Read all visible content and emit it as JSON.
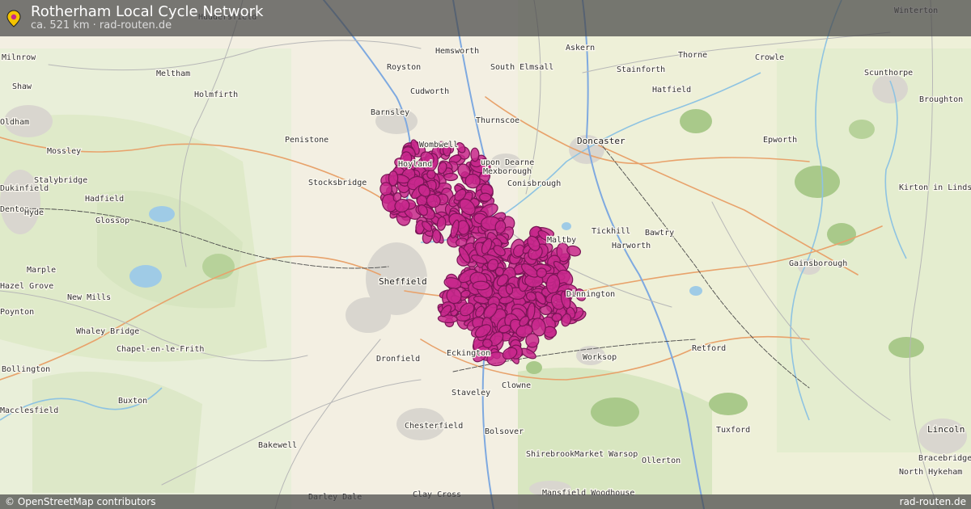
{
  "header": {
    "title": "Rotherham Local Cycle Network",
    "subtitle": "ca. 521 km · rad-routen.de"
  },
  "footer": {
    "attribution": "© OpenStreetMap contributors",
    "brand": "rad-routen.de"
  },
  "route_color": "#c8288c",
  "places": [
    {
      "name": "Huddersfield",
      "cls": "place-halo"
    },
    {
      "name": "Winterton",
      "cls": "place-halo"
    },
    {
      "name": "Milnrow",
      "cls": "place-halo"
    },
    {
      "name": "Meltham",
      "cls": "place-halo"
    },
    {
      "name": "Royston",
      "cls": "place-halo"
    },
    {
      "name": "Hemsworth",
      "cls": "place-halo"
    },
    {
      "name": "South Elmsall",
      "cls": "place-halo"
    },
    {
      "name": "Askern",
      "cls": "place-halo"
    },
    {
      "name": "Thorne",
      "cls": "place-halo"
    },
    {
      "name": "Crowle",
      "cls": "place-halo"
    },
    {
      "name": "Stainforth",
      "cls": "place-halo"
    },
    {
      "name": "Scunthorpe",
      "cls": "place-halo"
    },
    {
      "name": "Shaw",
      "cls": "place-halo"
    },
    {
      "name": "Holmfirth",
      "cls": "place-halo"
    },
    {
      "name": "Cudworth",
      "cls": "place-halo"
    },
    {
      "name": "Hatfield",
      "cls": "place-halo"
    },
    {
      "name": "Broughton",
      "cls": "place-halo"
    },
    {
      "name": "Oldham",
      "cls": "place-halo"
    },
    {
      "name": "Barnsley",
      "cls": "place-halo"
    },
    {
      "name": "Thurnscoe",
      "cls": "place-halo"
    },
    {
      "name": "Mossley",
      "cls": "place-halo"
    },
    {
      "name": "Penistone",
      "cls": "place-halo"
    },
    {
      "name": "Wombwell",
      "cls": "place-halo"
    },
    {
      "name": "Doncaster",
      "cls": "city"
    },
    {
      "name": "Epworth",
      "cls": "place-halo"
    },
    {
      "name": "Hoyland",
      "cls": "place-halo"
    },
    {
      "name": "upon Dearne",
      "cls": "place-halo"
    },
    {
      "name": "Mexborough",
      "cls": "place-halo"
    },
    {
      "name": "Stalybridge",
      "cls": "place-halo"
    },
    {
      "name": "Stocksbridge",
      "cls": "place-halo"
    },
    {
      "name": "Conisbrough",
      "cls": "place-halo"
    },
    {
      "name": "Dukinfield",
      "cls": "place-halo"
    },
    {
      "name": "Kirton in Lindsey",
      "cls": "place-halo"
    },
    {
      "name": "Hadfield",
      "cls": "place-halo"
    },
    {
      "name": "Denton",
      "cls": "place-halo"
    },
    {
      "name": "Hyde",
      "cls": "place-halo"
    },
    {
      "name": "Glossop",
      "cls": "place-halo"
    },
    {
      "name": "Tickhill",
      "cls": "place-halo"
    },
    {
      "name": "Bawtry",
      "cls": "place-halo"
    },
    {
      "name": "Maltby",
      "cls": "place-halo"
    },
    {
      "name": "Harworth",
      "cls": "place-halo"
    },
    {
      "name": "Marple",
      "cls": "place-halo"
    },
    {
      "name": "Gainsborough",
      "cls": "place-halo"
    },
    {
      "name": "Sheffield",
      "cls": "city"
    },
    {
      "name": "Hazel Grove",
      "cls": "place-halo"
    },
    {
      "name": "New Mills",
      "cls": "place-halo"
    },
    {
      "name": "Dinnington",
      "cls": "place-halo"
    },
    {
      "name": "Poynton",
      "cls": "place-halo"
    },
    {
      "name": "Whaley Bridge",
      "cls": "place-halo"
    },
    {
      "name": "Retford",
      "cls": "place-halo"
    },
    {
      "name": "Chapel-en-le-Frith",
      "cls": "place-halo"
    },
    {
      "name": "Dronfield",
      "cls": "place-halo"
    },
    {
      "name": "Eckington",
      "cls": "place-halo"
    },
    {
      "name": "Worksop",
      "cls": "place-halo"
    },
    {
      "name": "Bollington",
      "cls": "place-halo"
    },
    {
      "name": "Clowne",
      "cls": "place-halo"
    },
    {
      "name": "Staveley",
      "cls": "place-halo"
    },
    {
      "name": "Buxton",
      "cls": "place-halo"
    },
    {
      "name": "Macclesfield",
      "cls": "place-halo"
    },
    {
      "name": "Chesterfield",
      "cls": "place-halo"
    },
    {
      "name": "Bolsover",
      "cls": "place-halo"
    },
    {
      "name": "Tuxford",
      "cls": "place-halo"
    },
    {
      "name": "Lincoln",
      "cls": "city"
    },
    {
      "name": "Bakewell",
      "cls": "place-halo"
    },
    {
      "name": "Shirebrook",
      "cls": "place-halo"
    },
    {
      "name": "Market Warsop",
      "cls": "place-halo"
    },
    {
      "name": "Ollerton",
      "cls": "place-halo"
    },
    {
      "name": "Bracebridge",
      "cls": "place-halo"
    },
    {
      "name": "North Hykeham",
      "cls": "place-halo"
    },
    {
      "name": "Darley Dale",
      "cls": "place-halo"
    },
    {
      "name": "Clay Cross",
      "cls": "place-halo"
    },
    {
      "name": "Mansfield Woodhouse",
      "cls": "place-halo"
    }
  ]
}
